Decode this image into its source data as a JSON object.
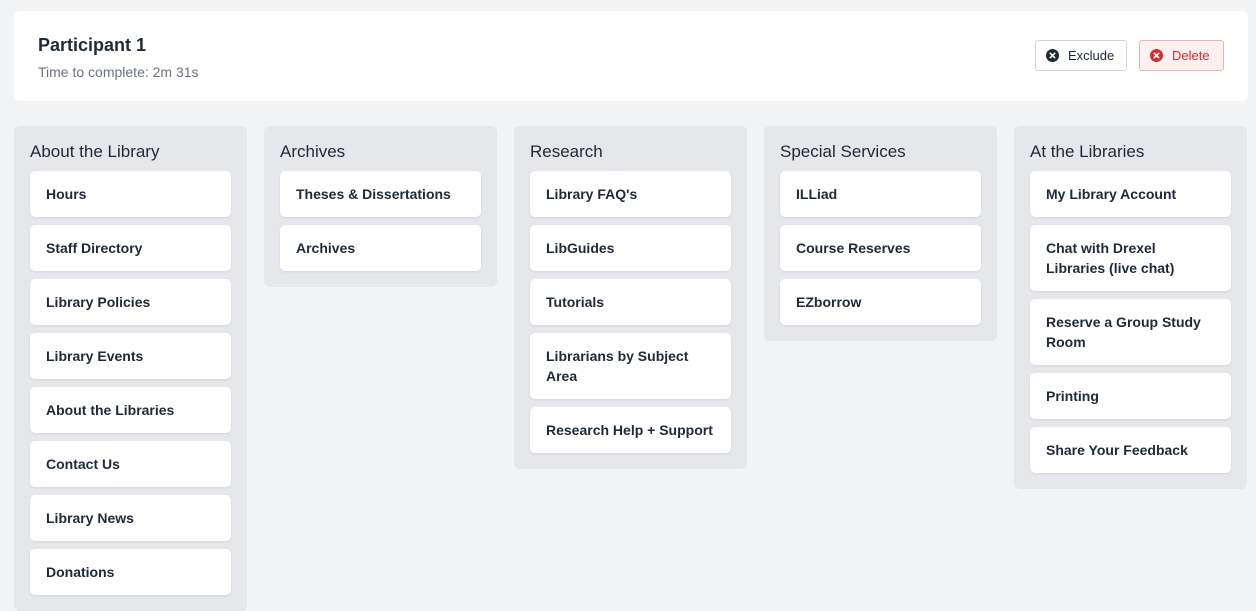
{
  "participant": {
    "name": "Participant 1",
    "time_label": "Time to complete: 2m 31s"
  },
  "actions": {
    "exclude_label": "Exclude",
    "exclude_icon": "x-circle-icon",
    "delete_label": "Delete",
    "delete_icon": "x-circle-icon",
    "delete_color": "#d32f2f"
  },
  "categories": [
    {
      "title": "About the Library",
      "cards": [
        "Hours",
        "Staff Directory",
        "Library Policies",
        "Library Events",
        "About the Libraries",
        "Contact Us",
        "Library News",
        "Donations"
      ]
    },
    {
      "title": "Archives",
      "cards": [
        "Theses & Dissertations",
        "Archives"
      ]
    },
    {
      "title": "Research",
      "cards": [
        "Library FAQ's",
        "LibGuides",
        "Tutorials",
        "Librarians by Subject Area",
        "Research Help + Support"
      ]
    },
    {
      "title": "Special Services",
      "cards": [
        "ILLiad",
        "Course Reserves",
        "EZborrow"
      ]
    },
    {
      "title": "At the Libraries",
      "cards": [
        "My Library Account",
        "Chat with Drexel Libraries (live chat)",
        "Reserve a Group Study Room",
        "Printing",
        "Share Your Feedback"
      ]
    }
  ]
}
